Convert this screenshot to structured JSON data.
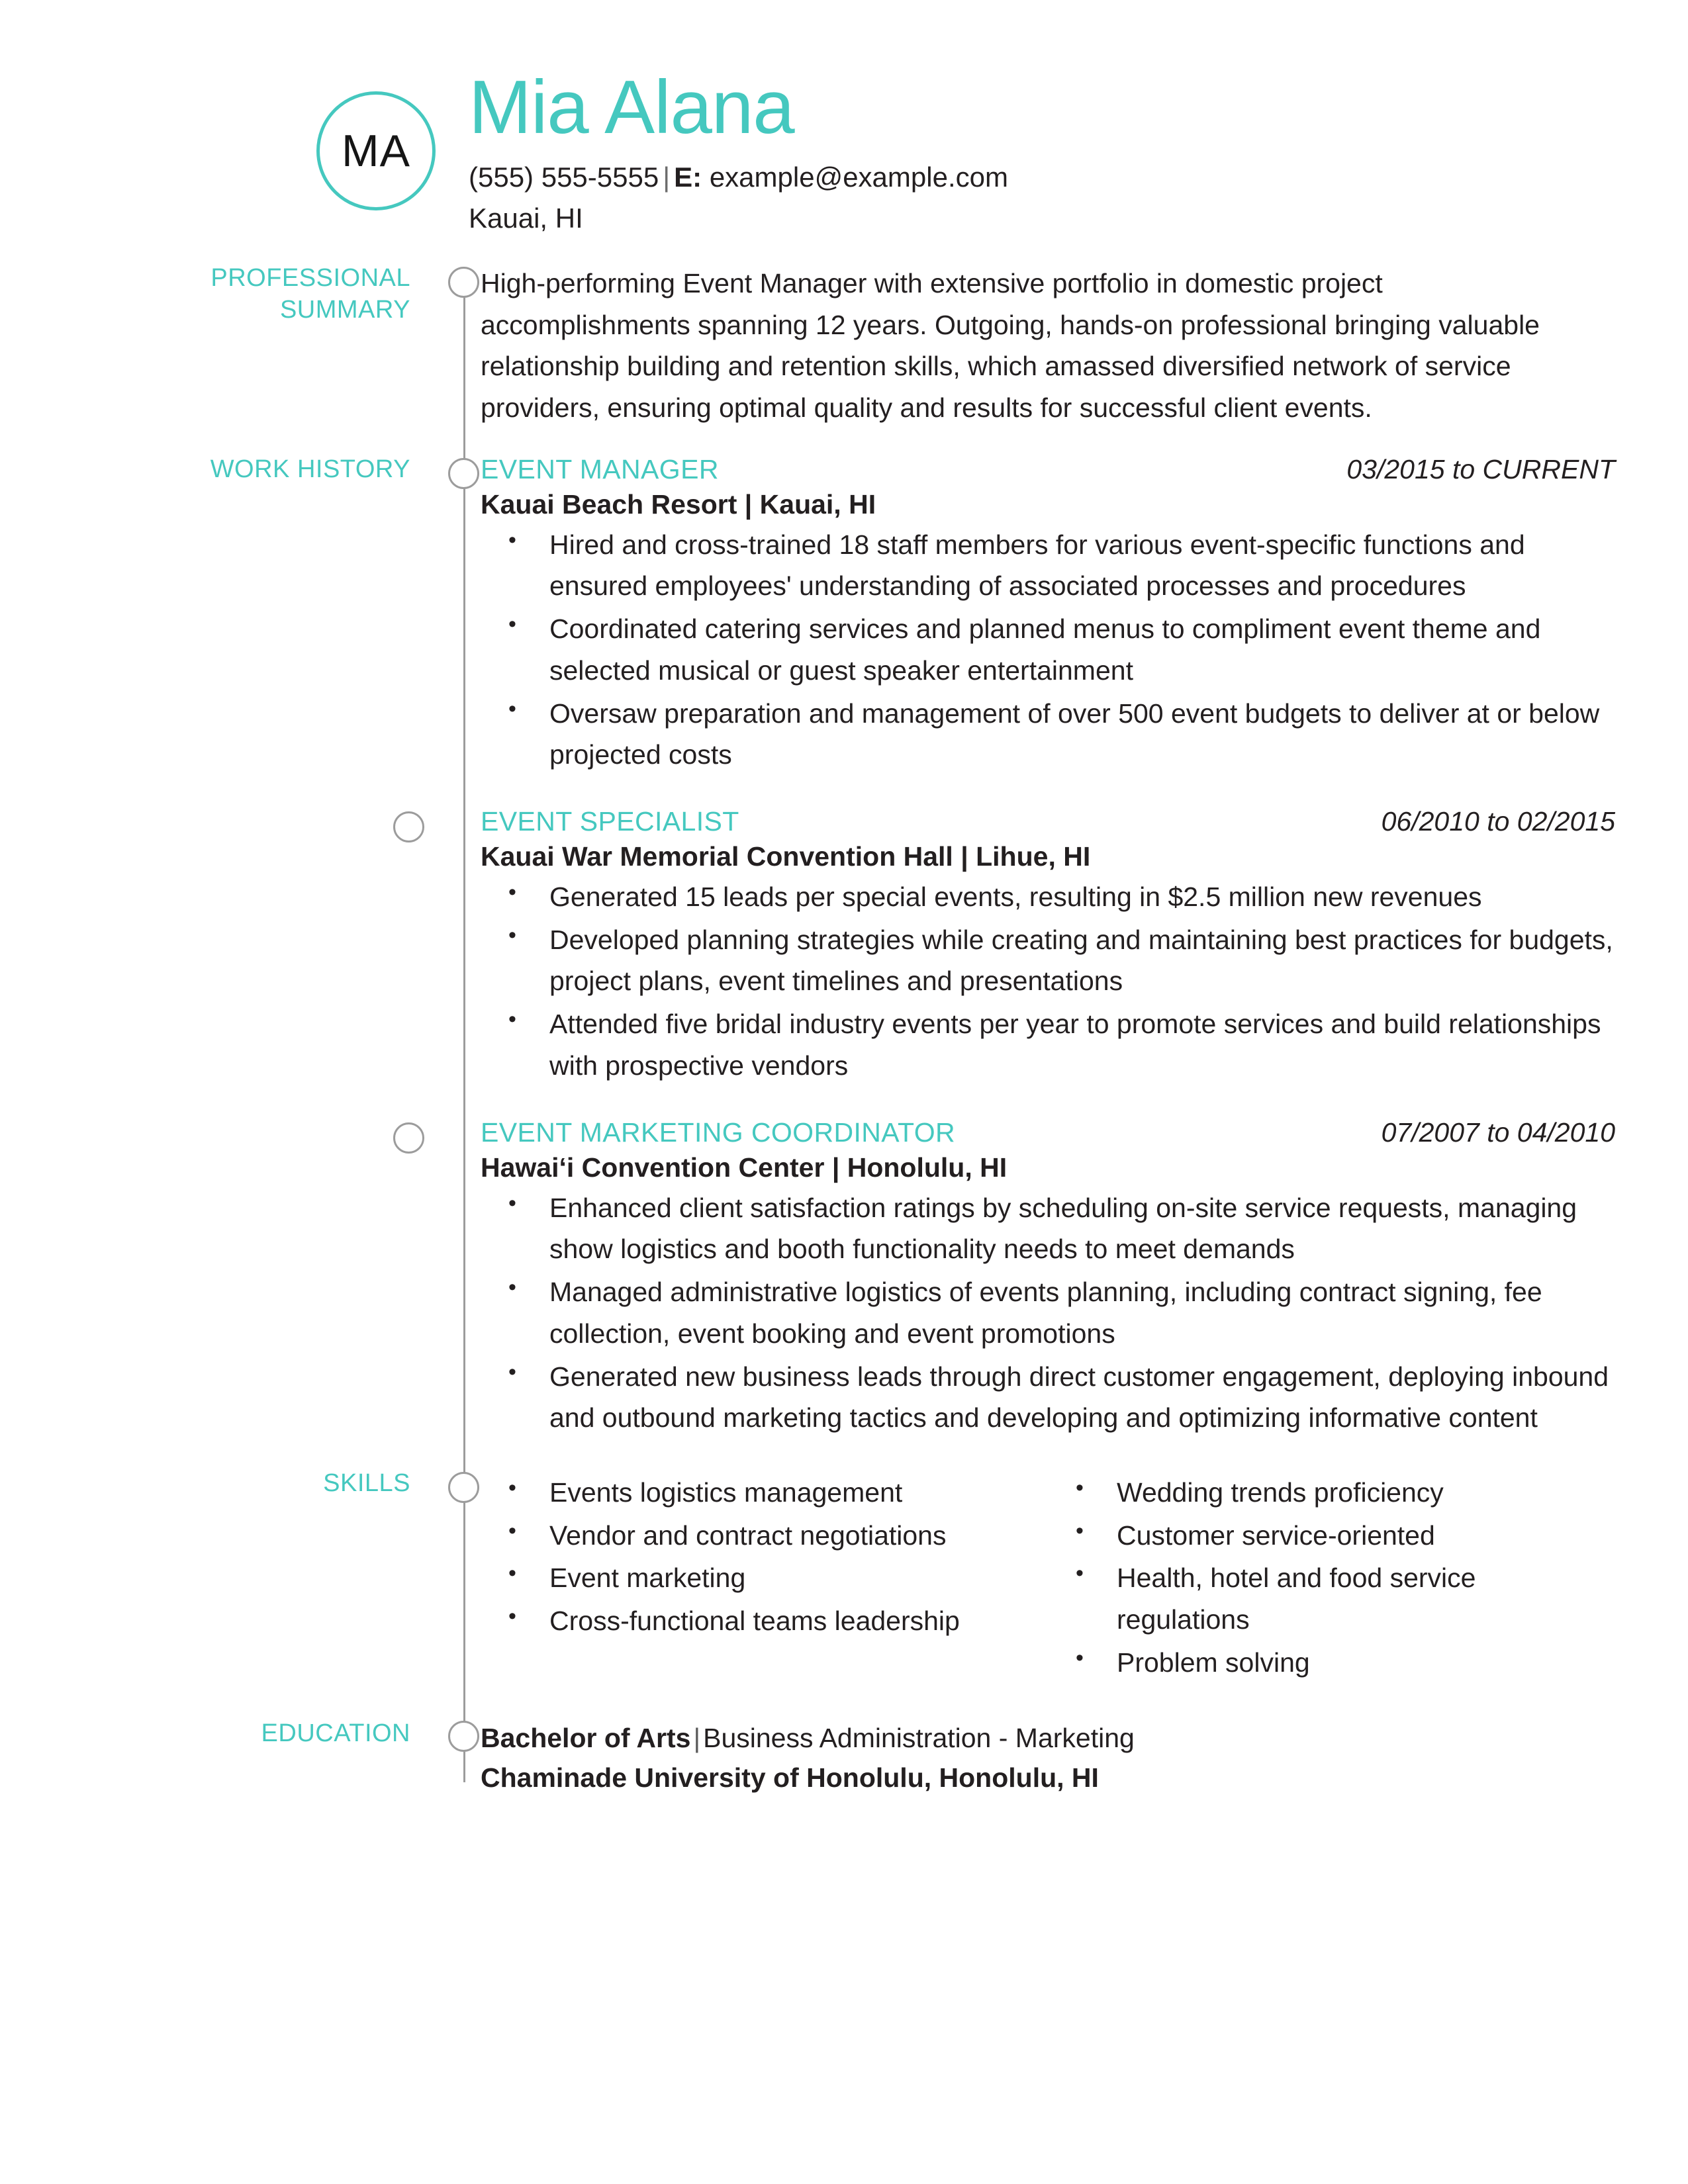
{
  "header": {
    "avatar_initials": "MA",
    "name": "Mia Alana",
    "phone": "(555) 555-5555",
    "separator": "|",
    "email_label": "E:",
    "email": "example@example.com",
    "location": "Kauai, HI"
  },
  "sections": {
    "summary": {
      "label_line1": "PROFESSIONAL",
      "label_line2": "SUMMARY",
      "text": "High-performing Event Manager with extensive portfolio in domestic project accomplishments spanning 12 years. Outgoing, hands-on professional bringing valuable relationship building and retention skills, which amassed diversified network of service providers, ensuring optimal quality and results for successful client events."
    },
    "work_history": {
      "label": "WORK HISTORY",
      "jobs": [
        {
          "title": "EVENT MANAGER",
          "dates": "03/2015 to CURRENT",
          "company": "Kauai Beach Resort",
          "location": "Kauai, HI",
          "bullets": [
            "Hired and cross-trained 18 staff members for various event-specific functions and ensured employees' understanding of associated processes and procedures",
            "Coordinated catering services and planned menus to compliment event theme and selected musical or guest speaker entertainment",
            "Oversaw preparation and management of over 500 event budgets to deliver at or below projected costs"
          ]
        },
        {
          "title": "EVENT SPECIALIST",
          "dates": "06/2010 to 02/2015",
          "company": "Kauai War Memorial Convention Hall",
          "location": "Lihue, HI",
          "bullets": [
            "Generated 15 leads per special events, resulting in $2.5 million new revenues",
            "Developed planning strategies while creating and maintaining best practices for budgets, project plans, event timelines and presentations",
            "Attended five bridal industry events per year to promote services and build relationships with prospective vendors"
          ]
        },
        {
          "title": "EVENT MARKETING COORDINATOR",
          "dates": "07/2007 to 04/2010",
          "company": "Hawaiʻi Convention Center",
          "location": "Honolulu, HI",
          "bullets": [
            "Enhanced client satisfaction ratings by scheduling on-site service requests, managing show logistics and booth functionality needs to meet demands",
            "Managed administrative logistics of events planning, including contract signing, fee collection, event booking and event promotions",
            "Generated new business leads through direct customer engagement, deploying inbound and outbound marketing tactics and developing and optimizing informative content"
          ]
        }
      ]
    },
    "skills": {
      "label": "SKILLS",
      "column_left": [
        "Events logistics management",
        "Vendor and contract negotiations",
        "Event marketing",
        "Cross-functional teams leadership"
      ],
      "column_right": [
        "Wedding trends proficiency",
        "Customer service-oriented",
        "Health, hotel and food service regulations",
        "Problem solving"
      ]
    },
    "education": {
      "label": "EDUCATION",
      "degree": "Bachelor of Arts",
      "separator": "|",
      "field": "Business Administration - Marketing",
      "school": "Chaminade University of Honolulu, Honolulu, HI"
    }
  },
  "colors": {
    "accent": "#45c8bf",
    "text": "#231f20",
    "rail": "#9c9c9c"
  }
}
